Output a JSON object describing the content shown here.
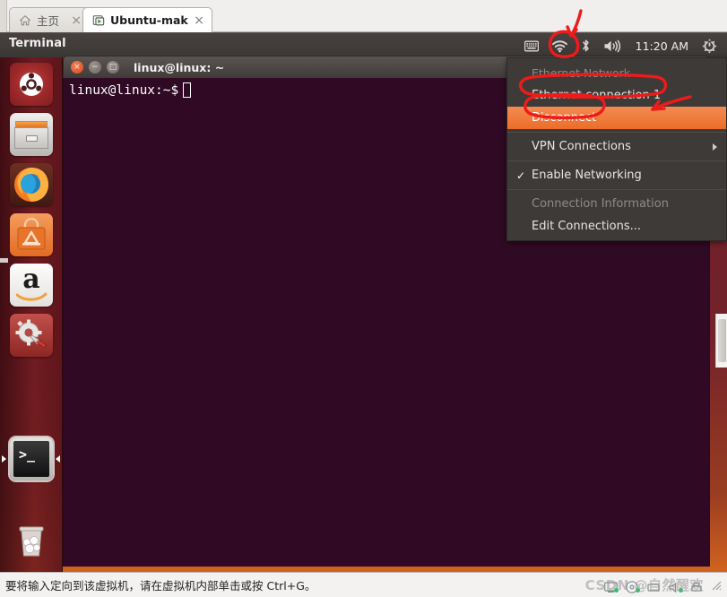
{
  "vmware": {
    "tabs": [
      {
        "label": "主页",
        "icon": "home-icon",
        "active": false,
        "close": "×"
      },
      {
        "label": "Ubuntu-makeru",
        "icon": "vm-icon",
        "active": true,
        "close": "×"
      }
    ],
    "status_text": "要将输入定向到该虚拟机，请在虚拟机内部单击或按 Ctrl+G。",
    "watermark": "CSDN @自然醒欢"
  },
  "panel": {
    "title": "Terminal",
    "clock": "11:20 AM",
    "tray": [
      {
        "name": "keyboard-indicator-icon"
      },
      {
        "name": "wifi-network-icon"
      },
      {
        "name": "bluetooth-icon"
      },
      {
        "name": "volume-icon"
      },
      {
        "name": "power-gear-icon"
      }
    ]
  },
  "launcher": {
    "items": [
      {
        "name": "ubuntu-dash-icon",
        "label": "Dash"
      },
      {
        "name": "files-nautilus-icon",
        "label": "Files"
      },
      {
        "name": "firefox-icon",
        "label": "Firefox"
      },
      {
        "name": "ubuntu-software-icon",
        "label": "Ubuntu Software"
      },
      {
        "name": "amazon-icon",
        "label": "Amazon"
      },
      {
        "name": "system-settings-icon",
        "label": "System Settings"
      },
      {
        "name": "terminal-icon",
        "label": "Terminal"
      },
      {
        "name": "trash-icon",
        "label": "Trash"
      }
    ]
  },
  "terminal": {
    "title": "linux@linux: ~",
    "prompt": "linux@linux:~$",
    "buttons": {
      "close": "×",
      "minimize": "−",
      "maximize": "□"
    }
  },
  "network_menu": {
    "items": [
      {
        "label": "Ethernet Network",
        "type": "header",
        "state": "disabled"
      },
      {
        "label": "Ethernet connection 1",
        "type": "item",
        "state": "normal"
      },
      {
        "label": "Disconnect",
        "type": "item",
        "state": "selected"
      },
      {
        "label": "VPN Connections",
        "type": "submenu",
        "state": "normal"
      },
      {
        "label": "Enable Networking",
        "type": "check",
        "state": "checked",
        "tick": "✓"
      },
      {
        "label": "Connection Information",
        "type": "item",
        "state": "disabled"
      },
      {
        "label": "Edit Connections...",
        "type": "item",
        "state": "normal"
      }
    ]
  },
  "colors": {
    "accent_orange": "#ec6d28",
    "menu_bg": "#3d3a38",
    "terminal_bg": "#300a24",
    "annotation_red": "#ee1b1b",
    "panel_bg": "#413d3b"
  }
}
